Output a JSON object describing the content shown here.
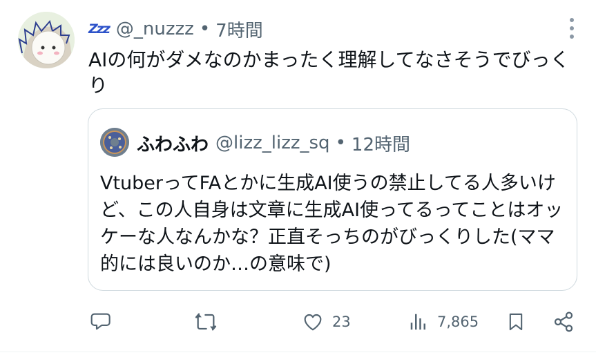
{
  "post": {
    "zzz_icon": "💤",
    "handle": "@_nuzzz",
    "separator": "•",
    "time": "7時間",
    "text": "AIの何がダメなのかまったく理解してなさそうでびっくり"
  },
  "quoted": {
    "name": "ふわふわ",
    "handle": "@lizz_lizz_sq",
    "separator": "•",
    "time": "12時間",
    "text": "VtuberってFAとかに生成AI使うの禁止してる人多いけど、この人自身は文章に生成AI使ってるってことはオッケーな人なんかな？正直そっちのがびっくりした(ママ的には良いのか…の意味で)"
  },
  "actions": {
    "reply_icon": "speech-bubble-icon",
    "repost_icon": "repost-icon",
    "like_icon": "heart-icon",
    "like_count": "23",
    "views_icon": "bar-chart-icon",
    "views_count": "7,865",
    "bookmark_icon": "bookmark-icon",
    "share_icon": "share-icon"
  },
  "colors": {
    "text": "#0f1419",
    "secondary": "#536471",
    "border": "#cfd9de",
    "zzz": "#2c52c9"
  }
}
